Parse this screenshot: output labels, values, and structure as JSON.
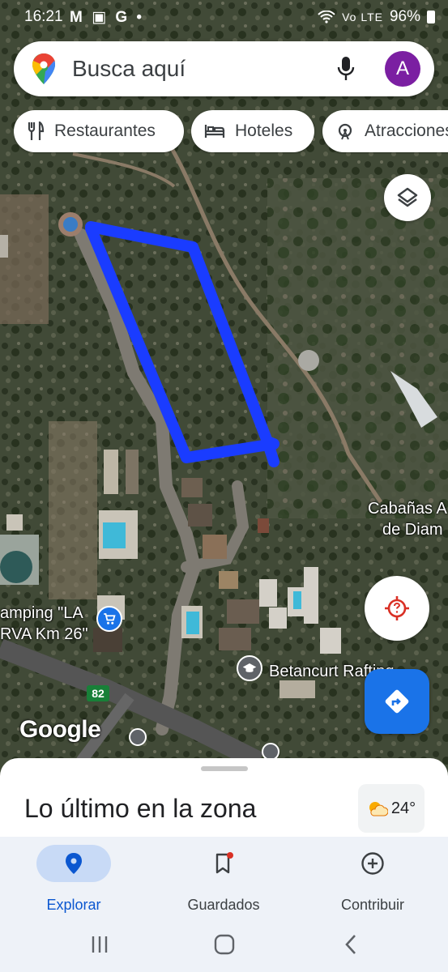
{
  "status_bar": {
    "time": "16:21",
    "notifications": "M ▣ G •",
    "signal": "Vo LTE",
    "battery": "96%"
  },
  "search": {
    "placeholder": "Busca aquí",
    "avatar_letter": "A"
  },
  "chips": [
    {
      "label": "Restaurantes",
      "icon": "fork-knife-icon"
    },
    {
      "label": "Hoteles",
      "icon": "bed-icon"
    },
    {
      "label": "Atracciones",
      "icon": "attractions-icon"
    }
  ],
  "map": {
    "labels": {
      "cabanas_line1": "Cabañas A",
      "cabanas_line2": "de Diam",
      "camping_line1": "amping \"LA",
      "camping_line2": "RVA Km 26\"",
      "betancurt": "Betancurt Rafting"
    },
    "route_number": "82",
    "attribution": "Google",
    "polygon_color": "#1a3cff"
  },
  "sheet": {
    "title": "Lo último en la zona",
    "weather_temp": "24°"
  },
  "bottom_nav": [
    {
      "label": "Explorar",
      "icon": "pin-icon",
      "active": true
    },
    {
      "label": "Guardados",
      "icon": "bookmark-icon",
      "active": false
    },
    {
      "label": "Contribuir",
      "icon": "add-circle-icon",
      "active": false
    }
  ],
  "colors": {
    "accent": "#1a73e8",
    "active_nav": "#0b57d0",
    "avatar": "#7b1fa2"
  }
}
